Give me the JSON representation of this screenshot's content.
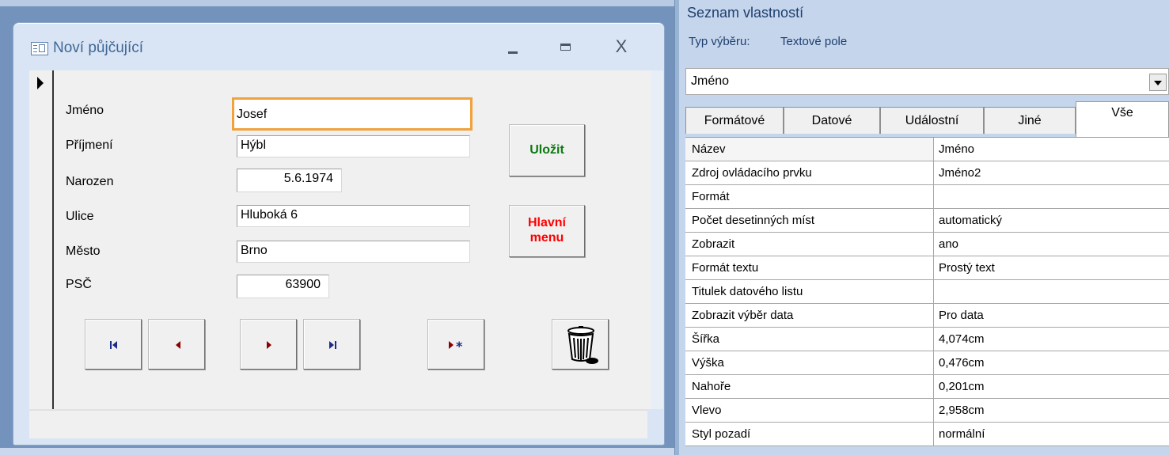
{
  "form": {
    "title": "Noví půjčující",
    "window_buttons": {
      "minimize": "_",
      "maximize": "□",
      "close": "X"
    },
    "fields": [
      {
        "label": "Jméno",
        "value": "Josef"
      },
      {
        "label": "Příjmení",
        "value": "Hýbl"
      },
      {
        "label": "Narozen",
        "value": "5.6.1974"
      },
      {
        "label": "Ulice",
        "value": "Hluboká 6"
      },
      {
        "label": "Město",
        "value": "Brno"
      },
      {
        "label": "PSČ",
        "value": "63900"
      }
    ],
    "buttons": {
      "save": "Uložit",
      "main_menu_line1": "Hlavní",
      "main_menu_line2": "menu"
    },
    "colors": {
      "save": "#0b7a10",
      "main_menu": "#ff0000",
      "selected_outline": "#f2a13c"
    },
    "nav_icons": [
      "first-record-icon",
      "previous-record-icon",
      "next-record-icon",
      "last-record-icon",
      "new-record-icon",
      "trash-icon"
    ]
  },
  "property_sheet": {
    "title": "Seznam vlastností",
    "selection_type_label": "Typ výběru:",
    "selection_type_value": "Textové pole",
    "object_combo": "Jméno",
    "tabs": [
      "Formátové",
      "Datové",
      "Událostní",
      "Jiné",
      "Vše"
    ],
    "active_tab": "Vše",
    "properties": [
      {
        "name": "Název",
        "value": "Jméno"
      },
      {
        "name": "Zdroj ovládacího prvku",
        "value": "Jméno2"
      },
      {
        "name": "Formát",
        "value": ""
      },
      {
        "name": "Počet desetinných míst",
        "value": "automatický"
      },
      {
        "name": "Zobrazit",
        "value": "ano"
      },
      {
        "name": "Formát textu",
        "value": "Prostý text"
      },
      {
        "name": "Titulek datového listu",
        "value": ""
      },
      {
        "name": "Zobrazit výběr data",
        "value": "Pro data"
      },
      {
        "name": "Šířka",
        "value": "4,074cm"
      },
      {
        "name": "Výška",
        "value": "0,476cm"
      },
      {
        "name": "Nahoře",
        "value": "0,201cm"
      },
      {
        "name": "Vlevo",
        "value": "2,958cm"
      },
      {
        "name": "Styl pozadí",
        "value": "normální"
      }
    ]
  }
}
